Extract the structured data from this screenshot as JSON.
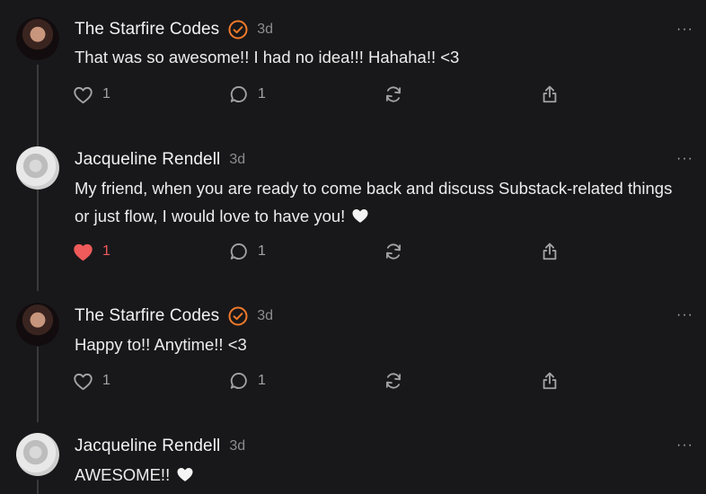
{
  "colors": {
    "background": "#18181a",
    "verified_badge": "#f27a2a",
    "liked_heart": "#ef5a5a",
    "muted": "#a3a3a5"
  },
  "comments": [
    {
      "author": "The Starfire Codes",
      "verified": true,
      "time": "3d",
      "text": "That was so awesome!! I had no idea!!! Hahaha!! <3",
      "likes": "1",
      "replies": "1",
      "liked": false,
      "avatar_icon": "avatar-photo"
    },
    {
      "author": "Jacqueline Rendell",
      "verified": false,
      "time": "3d",
      "text": "My friend, when you are ready to come back and discuss Substack-related things or just flow, I would love to have you!",
      "likes": "1",
      "replies": "1",
      "liked": true,
      "avatar_icon": "avatar-photo"
    },
    {
      "author": "The Starfire Codes",
      "verified": true,
      "time": "3d",
      "text": "Happy to!! Anytime!! <3",
      "likes": "1",
      "replies": "1",
      "liked": false,
      "avatar_icon": "avatar-photo"
    },
    {
      "author": "Jacqueline Rendell",
      "verified": false,
      "time": "3d",
      "text": "AWESOME!!",
      "avatar_icon": "avatar-photo"
    }
  ],
  "more_label": "···"
}
